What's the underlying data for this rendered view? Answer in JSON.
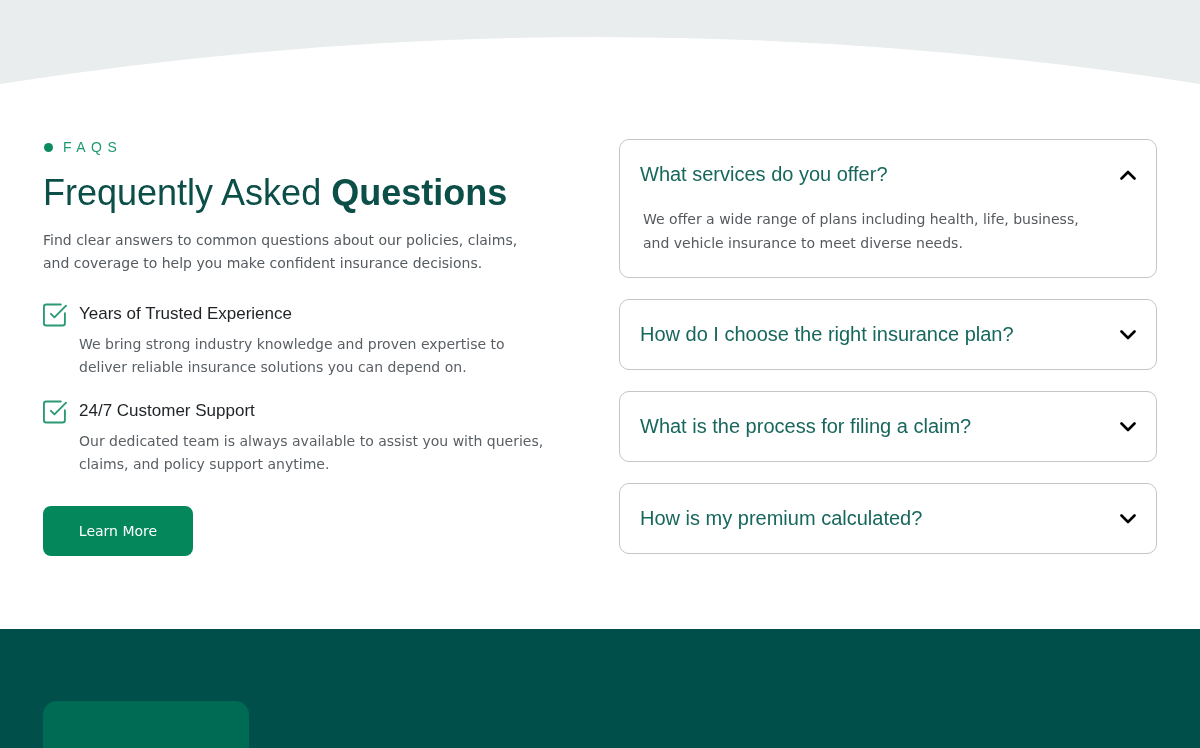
{
  "section_label": {
    "text": "FAQS"
  },
  "heading": "Frequently Asked **Questions**",
  "intro": "Find clear answers to common questions about our policies, claims, and coverage to help you make confident insurance decisions.",
  "features": [
    {
      "title": "Years of Trusted Experience",
      "description": "We bring strong industry knowledge and proven expertise to deliver reliable insurance solutions you can depend on."
    },
    {
      "title": "24/7 Customer Support",
      "description": "Our dedicated team is always available to assist you with queries, claims, and policy support anytime."
    }
  ],
  "button": {
    "label": "Learn More"
  },
  "faqs": [
    {
      "question": "What services do you offer?",
      "answer": "We offer a wide range of plans including health, life, business, and vehicle insurance to meet diverse needs.",
      "expanded": true
    },
    {
      "question": "How do I choose the right insurance plan?",
      "expanded": false
    },
    {
      "question": "What is the process for filing a claim?",
      "expanded": false
    },
    {
      "question": "How is my premium calculated?",
      "expanded": false
    }
  ]
}
